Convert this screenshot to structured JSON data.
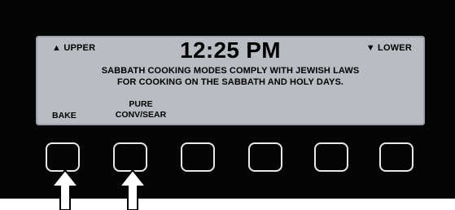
{
  "display": {
    "upper_label": "▲ UPPER",
    "lower_label": "▼ LOWER",
    "time": "12:25 PM",
    "message_line1": "SABBATH COOKING MODES COMPLY WITH JEWISH LAWS",
    "message_line2": "FOR COOKING ON THE SABBATH AND HOLY DAYS."
  },
  "soft_keys": [
    {
      "label": "BAKE"
    },
    {
      "label_line1": "PURE",
      "label_line2": "CONV/SEAR"
    }
  ],
  "colors": {
    "panel": "#050505",
    "lcd": "#b9bcc2",
    "button_border": "#e8e8e8",
    "arrow": "#ffffff"
  },
  "indicators": [
    "up-arrow-icon",
    "up-arrow-icon"
  ]
}
